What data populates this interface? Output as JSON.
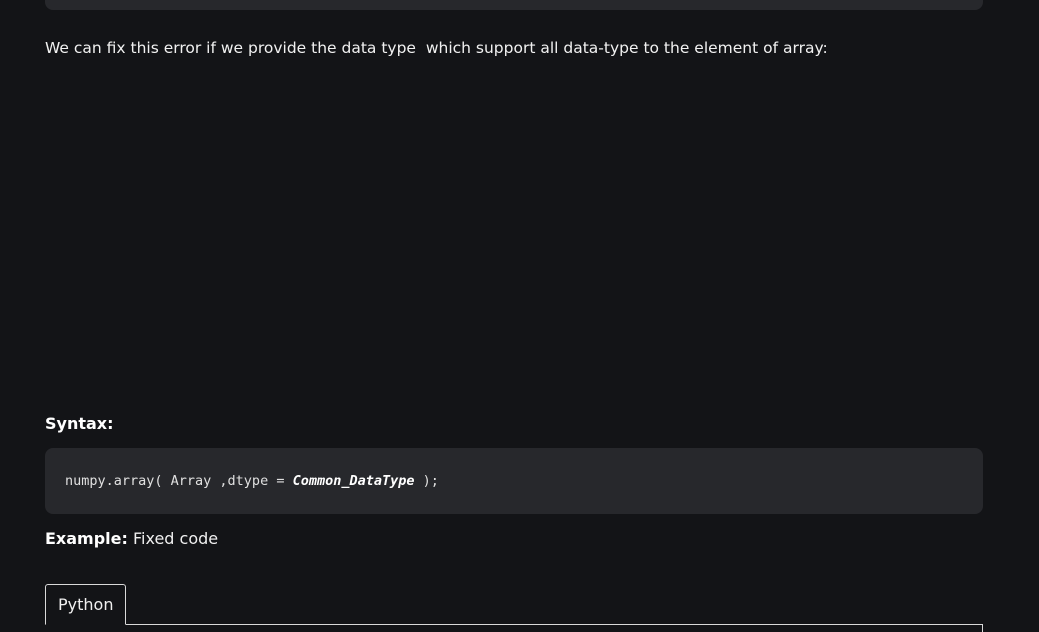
{
  "article": {
    "intro": "We can fix this error if we provide the data type  which support all data-type to the element of array:",
    "syntax_heading": "Syntax:",
    "syntax_code": {
      "prefix": "numpy.array( Array ,dtype = ",
      "emphasis": "Common_DataType",
      "suffix": " );"
    },
    "example_label": "Example:",
    "example_text": " Fixed code",
    "code_tabs": [
      {
        "label": "Python",
        "selected": true
      }
    ]
  },
  "colors": {
    "background": "#131417",
    "code_block": "#27282c",
    "text": "#f1f1f1"
  }
}
